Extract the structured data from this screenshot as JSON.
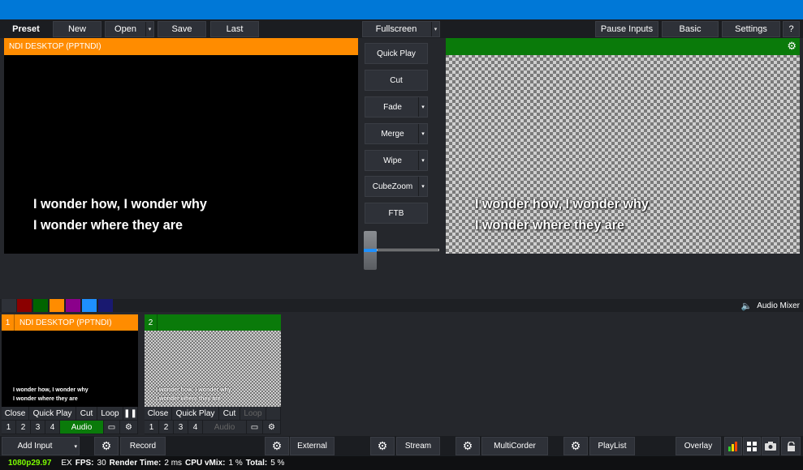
{
  "topbar": {
    "preset": "Preset",
    "new": "New",
    "open": "Open",
    "save": "Save",
    "last": "Last",
    "fullscreen": "Fullscreen",
    "pause_inputs": "Pause Inputs",
    "basic": "Basic",
    "settings": "Settings",
    "help": "?"
  },
  "preview": {
    "title": "NDI DESKTOP (PPTNDI)",
    "line1": "I wonder how, I wonder why",
    "line2": "I wonder where they are"
  },
  "output": {
    "line1": "I wonder how, I wonder why",
    "line2": "I wonder where they are"
  },
  "transitions": {
    "quick_play": "Quick Play",
    "cut": "Cut",
    "fade": "Fade",
    "merge": "Merge",
    "wipe": "Wipe",
    "cubezoom": "CubeZoom",
    "ftb": "FTB",
    "tbar_position": 0
  },
  "colours": {
    "swatches": [
      "#2e3138",
      "#8b0000",
      "#006400",
      "#ff8c00",
      "#8b008b",
      "#1e90ff",
      "#191970"
    ]
  },
  "audio_mixer": "Audio Mixer",
  "inputs": [
    {
      "number": "1",
      "title": "NDI DESKTOP (PPTNDI)",
      "line1": "I wonder how, I wonder why",
      "line2": "I wonder where they are",
      "close": "Close",
      "quick_play": "Quick Play",
      "cut": "Cut",
      "loop": "Loop",
      "n1": "1",
      "n2": "2",
      "n3": "3",
      "n4": "4",
      "audio": "Audio"
    },
    {
      "number": "2",
      "title": "",
      "line1": "I wonder how, I wonder why",
      "line2": "I wonder where they are",
      "close": "Close",
      "quick_play": "Quick Play",
      "cut": "Cut",
      "loop": "Loop",
      "n1": "1",
      "n2": "2",
      "n3": "3",
      "n4": "4",
      "audio": "Audio"
    }
  ],
  "bottombar": {
    "add_input": "Add Input",
    "record": "Record",
    "external": "External",
    "stream": "Stream",
    "multicorder": "MultiCorder",
    "playlist": "PlayList",
    "overlay": "Overlay"
  },
  "status": {
    "format": "1080p29.97",
    "ex": "EX",
    "fps_label": "FPS:",
    "fps": "30",
    "render_label": "Render Time:",
    "render": "2 ms",
    "cpu_label": "CPU vMix:",
    "cpu": "1 %",
    "total_label": "Total:",
    "total": "5 %"
  },
  "colors": {
    "preview_accent": "#ff8c00",
    "program_accent": "#0a7a0a",
    "titlebar": "#0078d7"
  }
}
